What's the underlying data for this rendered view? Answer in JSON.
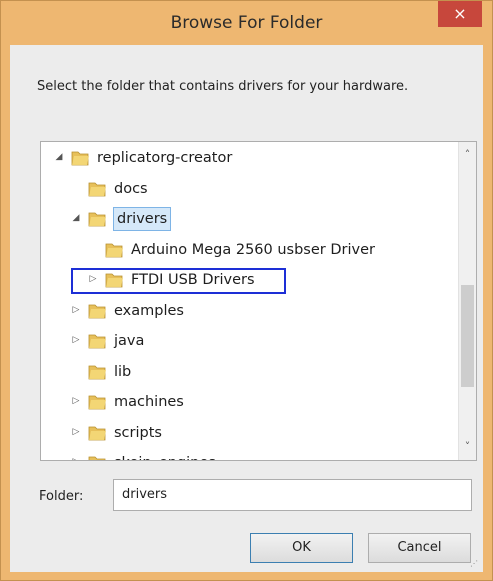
{
  "window": {
    "title": "Browse For Folder",
    "close_glyph": "×"
  },
  "prompt": "Select the folder that contains drivers for your hardware.",
  "tree": {
    "items": [
      {
        "label": "replicatorg-creator",
        "toggle": "◢",
        "level": 0
      },
      {
        "label": "docs",
        "toggle": "",
        "level": 1
      },
      {
        "label": "drivers",
        "toggle": "◢",
        "level": 1,
        "selected": true
      },
      {
        "label": "Arduino Mega 2560 usbser Driver",
        "toggle": "",
        "level": 2
      },
      {
        "label": "FTDI USB Drivers",
        "toggle": "▷",
        "level": 2,
        "highlighted": true
      },
      {
        "label": "examples",
        "toggle": "▷",
        "level": 1
      },
      {
        "label": "java",
        "toggle": "▷",
        "level": 1
      },
      {
        "label": "lib",
        "toggle": "",
        "level": 1
      },
      {
        "label": "machines",
        "toggle": "▷",
        "level": 1
      },
      {
        "label": "scripts",
        "toggle": "▷",
        "level": 1
      },
      {
        "label": "skein_engines",
        "toggle": "▷",
        "level": 1
      }
    ],
    "scroll_up_glyph": "˄",
    "scroll_down_glyph": "˅"
  },
  "folder_field": {
    "label": "Folder:",
    "value": "drivers"
  },
  "buttons": {
    "ok": "OK",
    "cancel": "Cancel"
  },
  "colors": {
    "title_bar": "#eeb771",
    "close_button": "#c7473c",
    "selection": "#d5e8f9",
    "highlight_box": "#1d2fd6",
    "folder_icon": "#e7c05a"
  }
}
